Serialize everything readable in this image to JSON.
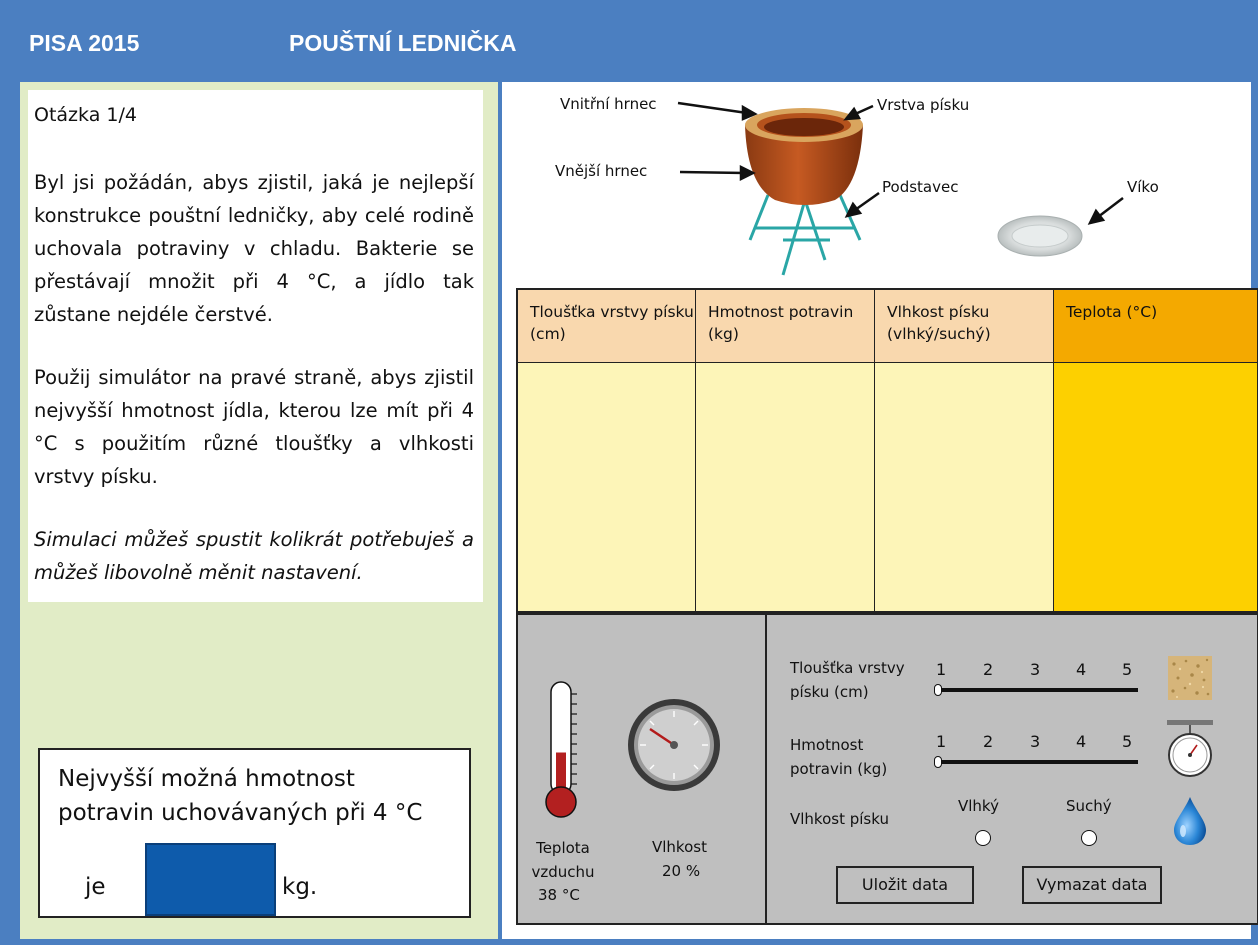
{
  "header": {
    "program": "PISA 2015",
    "title": "POUŠTNÍ LEDNIČKA"
  },
  "question": {
    "number": "Otázka 1/4",
    "paragraph1": "Byl jsi požádán, abys zjistil, jaká je nejlepší konstrukce pouštní ledničky, aby celé rodině uchovala potraviny v chladu. Bakterie se přestávají množit při 4 °C, a jídlo tak zůstane nejdéle čerstvé.",
    "paragraph2": "Použij simulátor na pravé straně, abys zjistil nejvyšší hmotnost jídla, kterou lze mít při 4 °C s použitím různé tloušťky a vlhkosti vrstvy písku.",
    "paragraph3": "Simulaci můžeš spustit kolikrát potřebuješ a můžeš libovolně měnit nastavení."
  },
  "answer": {
    "prompt": "Nejvyšší možná hmotnost potravin uchovávaných při 4 °C",
    "prefix": "je",
    "value": "",
    "suffix": "kg."
  },
  "diagram": {
    "inner_pot": "Vnitřní hrnec",
    "sand_layer": "Vrstva písku",
    "outer_pot": "Vnější hrnec",
    "stand": "Podstavec",
    "lid": "Víko"
  },
  "table": {
    "headers": [
      "Tloušťka vrstvy písku (cm)",
      "Hmotnost potravin (kg)",
      "Vlhkost písku (vlhký/suchý)",
      "Teplota (°C)"
    ],
    "rows": []
  },
  "environment": {
    "air_temp_label": "Teplota vzduchu",
    "air_temp_value": "38 °C",
    "humidity_label": "Vlhkost",
    "humidity_value": "20 %",
    "thermometer_fill": 0.45
  },
  "controls": {
    "sand_thickness": {
      "label": "Tloušťka vrstvy písku (cm)",
      "ticks": [
        "1",
        "2",
        "3",
        "4",
        "5"
      ],
      "value": 1
    },
    "food_weight": {
      "label": "Hmotnost potravin (kg)",
      "ticks": [
        "1",
        "2",
        "3",
        "4",
        "5"
      ],
      "value": 1
    },
    "sand_moisture": {
      "label": "Vlhkost písku",
      "options": [
        "Vlhký",
        "Suchý"
      ],
      "selected": null
    },
    "save_button": "Uložit data",
    "clear_button": "Vymazat data"
  },
  "colors": {
    "header": "#4b7fc1",
    "left_panel": "#e1ecc6",
    "table_header": "#f9d8ae",
    "table_cell": "#fdf5b8",
    "temp_header": "#f4a900",
    "temp_cell": "#fdd000",
    "answer_input": "#0e5bab",
    "controls_panel": "#bfbfbf"
  }
}
